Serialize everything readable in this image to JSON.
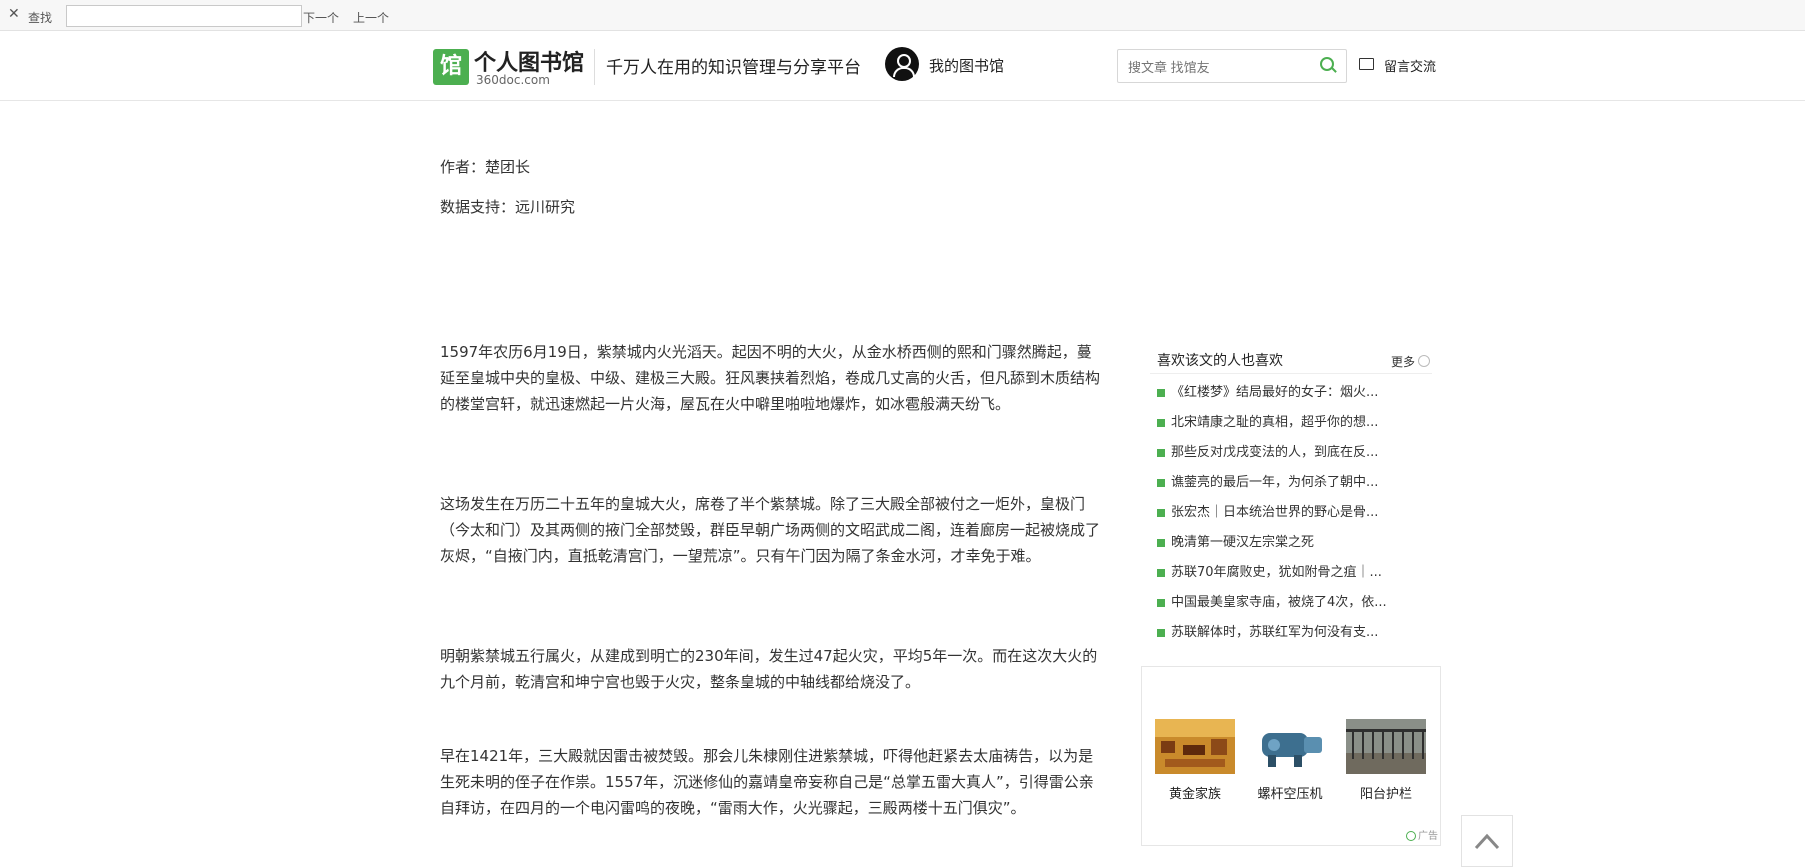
{
  "find_bar": {
    "close_glyph": "✕",
    "label": "查找",
    "value": "",
    "next_label": "下一个",
    "prev_label": "上一个"
  },
  "header": {
    "logo_glyph": "馆",
    "logo_title": "个人图书馆",
    "logo_sub": "360doc.com",
    "slogan": "千万人在用的知识管理与分享平台",
    "my_library": "我的图书馆",
    "search_placeholder": "搜文章 找馆友",
    "message_label": "留言交流"
  },
  "article": {
    "author_line": "作者：楚团长",
    "data_line": "数据支持：远川研究",
    "paragraphs": [
      "1597年农历6月19日，紫禁城内火光滔天。起因不明的大火，从金水桥西侧的熙和门骤然腾起，蔓延至皇城中央的皇极、中级、建极三大殿。狂风裹挟着烈焰，卷成几丈高的火舌，但凡舔到木质结构的楼堂宫轩，就迅速燃起一片火海，屋瓦在火中噼里啪啦地爆炸，如冰雹般满天纷飞。",
      "这场发生在万历二十五年的皇城大火，席卷了半个紫禁城。除了三大殿全部被付之一炬外，皇极门（今太和门）及其两侧的掖门全部焚毁，群臣早朝广场两侧的文昭武成二阁，连着廊房一起被烧成了灰烬，“自掖门内，直抵乾清宫门，一望荒凉”。只有午门因为隔了条金水河，才幸免于难。",
      "明朝紫禁城五行属火，从建成到明亡的230年间，发生过47起火灾，平均5年一次。而在这次大火的九个月前，乾清宫和坤宁宫也毁于火灾，整条皇城的中轴线都给烧没了。",
      "早在1421年，三大殿就因雷击被焚毁。那会儿朱棣刚住进紫禁城，吓得他赶紧去太庙祷告，以为是生死未明的侄子在作祟。1557年，沉迷修仙的嘉靖皇帝妄称自己是“总掌五雷大真人”，引得雷公亲自拜访，在四月的一个电闪雷鸣的夜晚，“雷雨大作，火光骤起，三殿两楼十五门俱灾”。"
    ]
  },
  "sidebar": {
    "title": "喜欢该文的人也喜欢",
    "more_label": "更多",
    "items": [
      "《红楼梦》结局最好的女子：烟火...",
      "北宋靖康之耻的真相，超乎你的想...",
      "那些反对戊戌变法的人，到底在反...",
      "谯蓥亮的最后一年，为何杀了朝中...",
      "张宏杰｜日本统治世界的野心是骨...",
      "晚清第一硬汉左宗棠之死",
      "苏联70年腐败史，犹如附骨之疽｜...",
      "中国最美皇家寺庙，被烧了4次，依...",
      "苏联解体时，苏联红军为何没有支..."
    ]
  },
  "ad": {
    "items": [
      {
        "label": "黄金家族",
        "icon": "golden-family-image"
      },
      {
        "label": "螺杆空压机",
        "icon": "screw-compressor-image"
      },
      {
        "label": "阳台护栏",
        "icon": "balcony-railing-image"
      }
    ],
    "tag": "广告"
  },
  "colors": {
    "accent_green": "#4caf50",
    "text_dark": "#333333",
    "border": "#e6e6e6"
  }
}
